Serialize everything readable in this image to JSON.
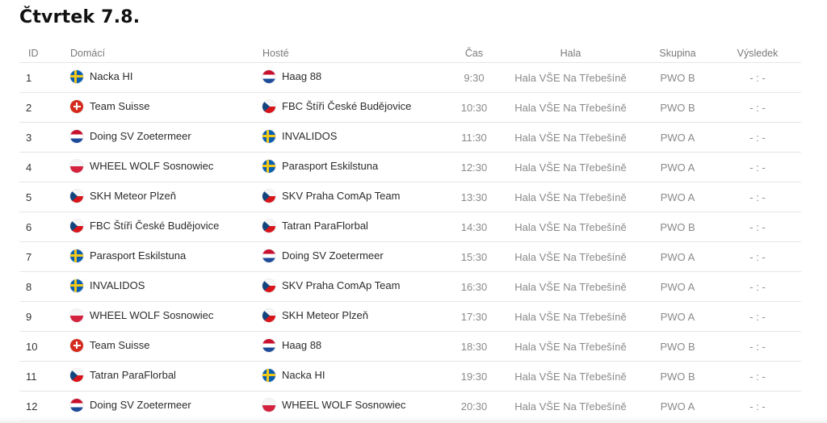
{
  "page": {
    "title": "Čtvrtek 7.8."
  },
  "headers": {
    "id": "ID",
    "home": "Domácí",
    "away": "Hosté",
    "time": "Čas",
    "hall": "Hala",
    "group": "Skupina",
    "result": "Výsledek"
  },
  "rows": [
    {
      "id": "1",
      "home": "Nacka HI",
      "home_flag": "se",
      "away": "Haag 88",
      "away_flag": "nl",
      "time": "9:30",
      "hall": "Hala VŠE Na Třebešíně",
      "group": "PWO B",
      "result": "- : -"
    },
    {
      "id": "2",
      "home": "Team Suisse",
      "home_flag": "ch",
      "away": "FBC Štíři České Budějovice",
      "away_flag": "cz",
      "time": "10:30",
      "hall": "Hala VŠE Na Třebešíně",
      "group": "PWO B",
      "result": "- : -"
    },
    {
      "id": "3",
      "home": "Doing SV Zoetermeer",
      "home_flag": "nl",
      "away": "INVALIDOS",
      "away_flag": "se",
      "time": "11:30",
      "hall": "Hala VŠE Na Třebešíně",
      "group": "PWO A",
      "result": "- : -"
    },
    {
      "id": "4",
      "home": "WHEEL WOLF Sosnowiec",
      "home_flag": "pl",
      "away": "Parasport Eskilstuna",
      "away_flag": "se",
      "time": "12:30",
      "hall": "Hala VŠE Na Třebešíně",
      "group": "PWO A",
      "result": "- : -"
    },
    {
      "id": "5",
      "home": "SKH Meteor Plzeň",
      "home_flag": "cz",
      "away": "SKV Praha ComAp Team",
      "away_flag": "cz",
      "time": "13:30",
      "hall": "Hala VŠE Na Třebešíně",
      "group": "PWO A",
      "result": "- : -"
    },
    {
      "id": "6",
      "home": "FBC Štíři České Budějovice",
      "home_flag": "cz",
      "away": "Tatran ParaFlorbal",
      "away_flag": "cz",
      "time": "14:30",
      "hall": "Hala VŠE Na Třebešíně",
      "group": "PWO B",
      "result": "- : -"
    },
    {
      "id": "7",
      "home": "Parasport Eskilstuna",
      "home_flag": "se",
      "away": "Doing SV Zoetermeer",
      "away_flag": "nl",
      "time": "15:30",
      "hall": "Hala VŠE Na Třebešíně",
      "group": "PWO A",
      "result": "- : -"
    },
    {
      "id": "8",
      "home": "INVALIDOS",
      "home_flag": "se",
      "away": "SKV Praha ComAp Team",
      "away_flag": "cz",
      "time": "16:30",
      "hall": "Hala VŠE Na Třebešíně",
      "group": "PWO A",
      "result": "- : -"
    },
    {
      "id": "9",
      "home": "WHEEL WOLF Sosnowiec",
      "home_flag": "pl",
      "away": "SKH Meteor Plzeň",
      "away_flag": "cz",
      "time": "17:30",
      "hall": "Hala VŠE Na Třebešíně",
      "group": "PWO A",
      "result": "- : -"
    },
    {
      "id": "10",
      "home": "Team Suisse",
      "home_flag": "ch",
      "away": "Haag 88",
      "away_flag": "nl",
      "time": "18:30",
      "hall": "Hala VŠE Na Třebešíně",
      "group": "PWO B",
      "result": "- : -"
    },
    {
      "id": "11",
      "home": "Tatran ParaFlorbal",
      "home_flag": "cz",
      "away": "Nacka HI",
      "away_flag": "se",
      "time": "19:30",
      "hall": "Hala VŠE Na Třebešíně",
      "group": "PWO B",
      "result": "- : -"
    },
    {
      "id": "12",
      "home": "Doing SV Zoetermeer",
      "home_flag": "nl",
      "away": "WHEEL WOLF Sosnowiec",
      "away_flag": "pl",
      "time": "20:30",
      "hall": "Hala VŠE Na Třebešíně",
      "group": "PWO A",
      "result": "- : -"
    }
  ]
}
